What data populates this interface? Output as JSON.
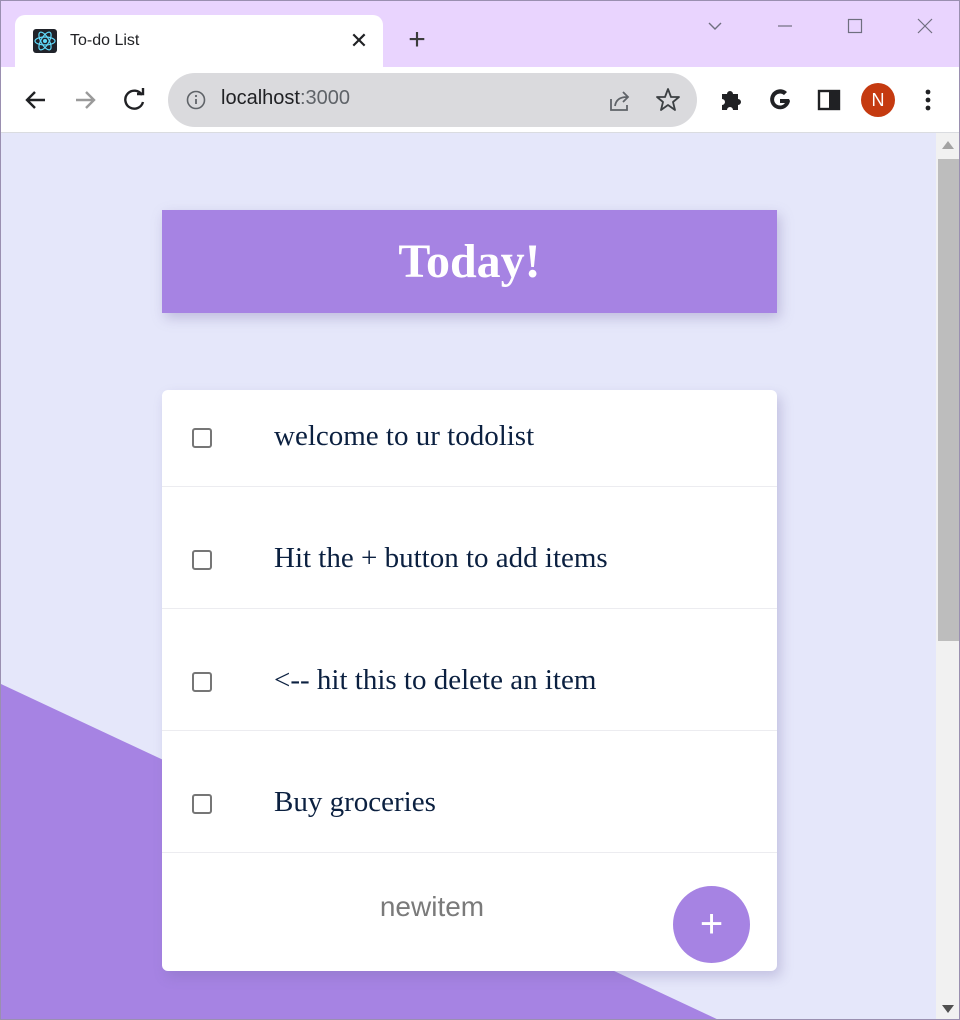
{
  "browser": {
    "tab_title": "To-do List",
    "tab_close": "✕",
    "new_tab": "+",
    "url_host": "localhost",
    "url_port": ":3000",
    "profile_initial": "N"
  },
  "page": {
    "heading": "Today!",
    "items": [
      {
        "text": "welcome to ur todolist",
        "checked": false
      },
      {
        "text": "Hit the + button to add items",
        "checked": false
      },
      {
        "text": "<-- hit this to delete an item",
        "checked": false
      },
      {
        "text": "Buy groceries",
        "checked": false
      }
    ],
    "new_item_placeholder": "newitem",
    "add_button_label": "+"
  },
  "colors": {
    "accent": "#a683e3",
    "page_bg": "#e5e7fa",
    "titlebar": "#e9d4fe",
    "item_text": "#0b2040"
  }
}
